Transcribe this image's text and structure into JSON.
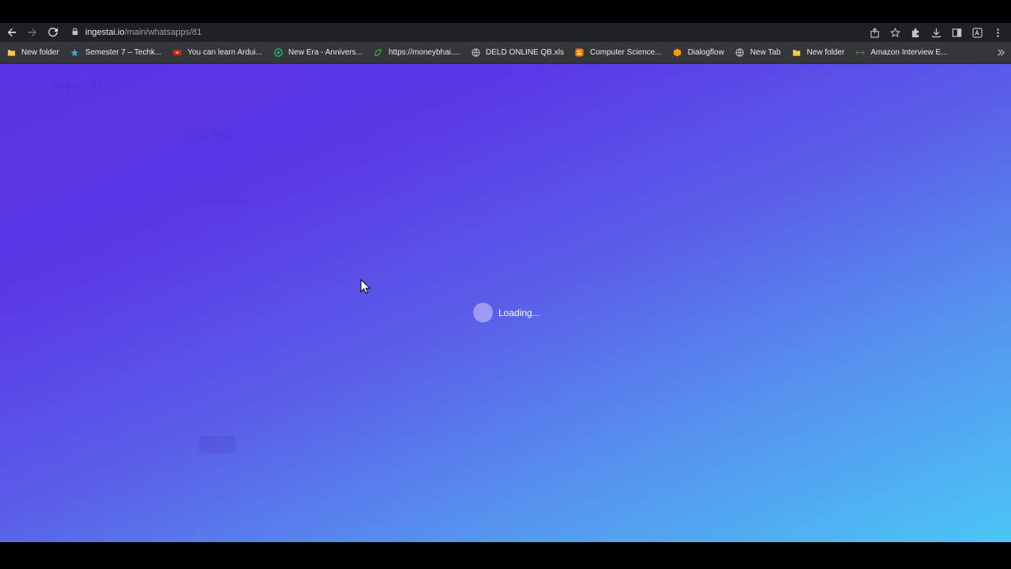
{
  "browser": {
    "url_host": "ingestai.io",
    "url_path": "/main/whatsapps/81",
    "bookmarks": [
      {
        "label": "New folder",
        "icon": "folder-icon",
        "color": "#f2c94c"
      },
      {
        "label": "Semester 7 – Techk...",
        "icon": "star-bookmark-icon",
        "color": "#4aa3df"
      },
      {
        "label": "You can learn Ardui...",
        "icon": "youtube-icon",
        "color": "#e62117"
      },
      {
        "label": "New Era - Annivers...",
        "icon": "chatgpt-icon",
        "color": "#19c37d"
      },
      {
        "label": "https://moneybhai....",
        "icon": "leaf-icon",
        "color": "#3cae3c"
      },
      {
        "label": "DELD ONLINE QB.xls",
        "icon": "globe-icon",
        "color": "#c4c7c5"
      },
      {
        "label": "Computer Science...",
        "icon": "blogger-icon",
        "color": "#f57d00"
      },
      {
        "label": "Dialogflow",
        "icon": "dialogflow-icon",
        "color": "#ff9800"
      },
      {
        "label": "New Tab",
        "icon": "globe-icon",
        "color": "#c4c7c5"
      },
      {
        "label": "New folder",
        "icon": "folder-icon",
        "color": "#f2c94c"
      },
      {
        "label": "Amazon Interview E...",
        "icon": "gfg-icon",
        "color": "#2f8d46"
      }
    ]
  },
  "page": {
    "loading_text": "Loading...",
    "gradient_start": "#5b34e4",
    "gradient_end": "#4ac6f5"
  }
}
